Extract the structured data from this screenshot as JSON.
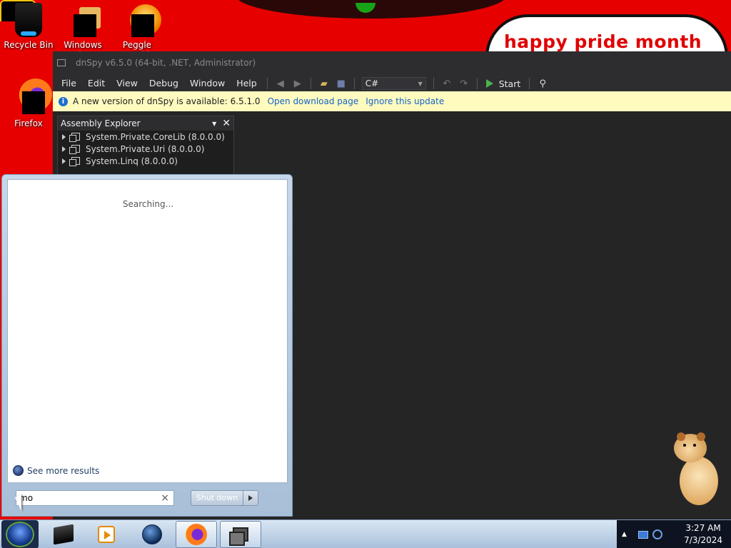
{
  "desktop": {
    "banner_text": "happy pride month",
    "icons": [
      {
        "label": "Recycle Bin",
        "icon": "recycle-bin-icon"
      },
      {
        "label": "Windows Live",
        "icon": "windows-live-icon"
      },
      {
        "label": "Peggle World",
        "icon": "peggle-world-icon"
      },
      {
        "label": "Firefox",
        "icon": "firefox-icon"
      }
    ]
  },
  "dnspy": {
    "title": "dnSpy v6.5.0 (64-bit, .NET, Administrator)",
    "menu": [
      "File",
      "Edit",
      "View",
      "Debug",
      "Window",
      "Help"
    ],
    "language": "C#",
    "start_label": "Start",
    "update_bar": {
      "message": "A new version of dnSpy is available: 6.5.1.0",
      "open_link": "Open download page",
      "ignore_link": "Ignore this update"
    },
    "assembly_explorer": {
      "title": "Assembly Explorer",
      "items": [
        "System.Private.CoreLib (8.0.0.0)",
        "System.Private.Uri (8.0.0.0)",
        "System.Linq (8.0.0.0)"
      ]
    }
  },
  "start_menu": {
    "status_text": "Searching...",
    "see_more": "See more results",
    "search_value": "mo",
    "shutdown_label": "Shut down"
  },
  "taskbar": {
    "apps": [
      "nas-drive-icon",
      "media-player-icon",
      "globe-icon",
      "firefox-icon",
      "dnspy-icon"
    ],
    "time": "3:27 AM",
    "date": "7/3/2024"
  },
  "colors": {
    "wallpaper": "#e60000",
    "dnspy_bg": "#2d2d30",
    "update_bar": "#fffbbf",
    "link": "#1462c9"
  }
}
